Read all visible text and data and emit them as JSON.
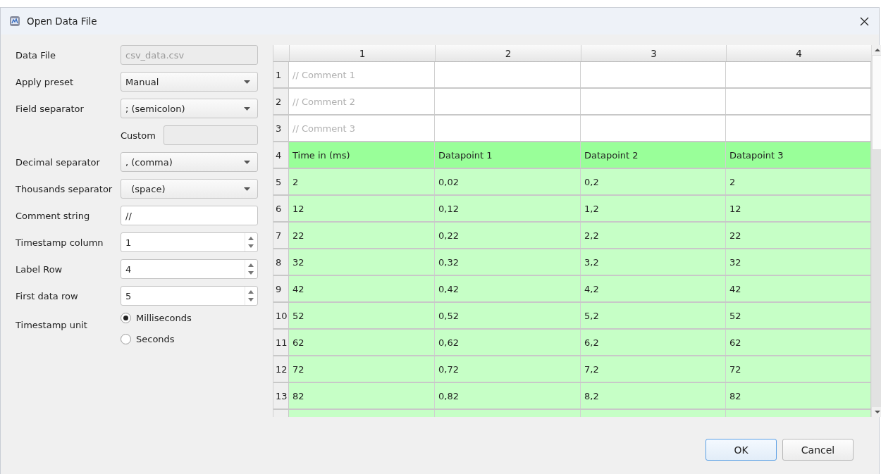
{
  "window": {
    "title": "Open Data File"
  },
  "form": [
    {
      "kind": "text",
      "label": "Data File",
      "value": "csv_data.csv",
      "disabled": true
    },
    {
      "kind": "select",
      "label": "Apply preset",
      "value": "Manual"
    },
    {
      "kind": "select",
      "label": "Field separator",
      "value": "; (semicolon)"
    },
    {
      "kind": "custom",
      "label": "Custom",
      "disabled": true
    },
    {
      "kind": "select",
      "label": "Decimal separator",
      "value": ", (comma)"
    },
    {
      "kind": "select",
      "label": "Thousands separator",
      "value": "  (space)"
    },
    {
      "kind": "text",
      "label": "Comment string",
      "value": "//",
      "disabled": false
    },
    {
      "kind": "spinner",
      "label": "Timestamp column",
      "value": "1"
    },
    {
      "kind": "spinner",
      "label": "Label Row",
      "value": "4"
    },
    {
      "kind": "spinner",
      "label": "First data row",
      "value": "5"
    },
    {
      "kind": "radio",
      "label": "Timestamp unit",
      "options": [
        {
          "label": "Milliseconds",
          "selected": true
        },
        {
          "label": "Seconds",
          "selected": false
        }
      ]
    }
  ],
  "table": {
    "columns": [
      "1",
      "2",
      "3",
      "4"
    ],
    "rows": [
      {
        "number": "1",
        "kind": "comment",
        "cells": [
          "// Comment 1"
        ]
      },
      {
        "number": "2",
        "kind": "comment",
        "cells": [
          "// Comment 2"
        ]
      },
      {
        "number": "3",
        "kind": "comment",
        "cells": [
          "// Comment 3"
        ]
      },
      {
        "number": "4",
        "kind": "label",
        "cells": [
          "Time in (ms)",
          "Datapoint 1",
          "Datapoint 2",
          "Datapoint 3"
        ]
      },
      {
        "number": "5",
        "kind": "data",
        "cells": [
          "2",
          "0,02",
          "0,2",
          "2"
        ]
      },
      {
        "number": "6",
        "kind": "data",
        "cells": [
          "12",
          "0,12",
          "1,2",
          "12"
        ]
      },
      {
        "number": "7",
        "kind": "data",
        "cells": [
          "22",
          "0,22",
          "2,2",
          "22"
        ]
      },
      {
        "number": "8",
        "kind": "data",
        "cells": [
          "32",
          "0,32",
          "3,2",
          "32"
        ]
      },
      {
        "number": "9",
        "kind": "data",
        "cells": [
          "42",
          "0,42",
          "4,2",
          "42"
        ]
      },
      {
        "number": "10",
        "kind": "data",
        "cells": [
          "52",
          "0,52",
          "5,2",
          "52"
        ]
      },
      {
        "number": "11",
        "kind": "data",
        "cells": [
          "62",
          "0,62",
          "6,2",
          "62"
        ]
      },
      {
        "number": "12",
        "kind": "data",
        "cells": [
          "72",
          "0,72",
          "7,2",
          "72"
        ]
      },
      {
        "number": "13",
        "kind": "data",
        "cells": [
          "82",
          "0,82",
          "8,2",
          "82"
        ]
      }
    ]
  },
  "buttons": [
    "OK",
    "Cancel"
  ]
}
